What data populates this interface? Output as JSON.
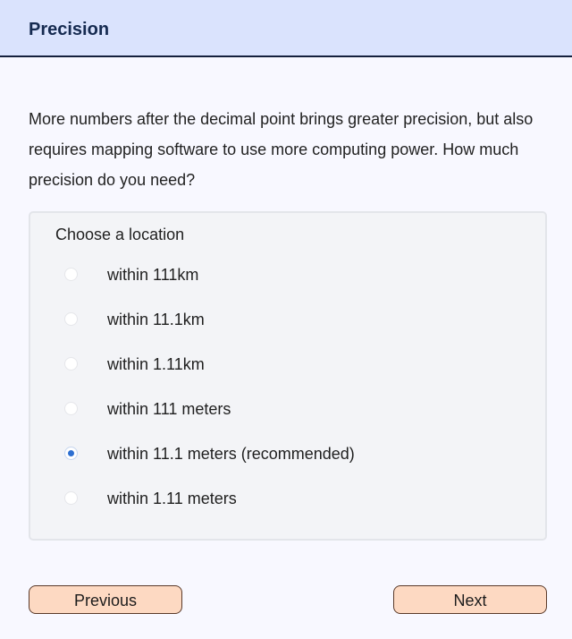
{
  "header": {
    "title": "Precision"
  },
  "intro": {
    "text": "More numbers after the decimal point brings greater precision, but also requires mapping software to use more computing power. How much precision do you need?"
  },
  "question": {
    "legend": "Choose a location",
    "options": [
      {
        "label": "within 111km",
        "checked": false
      },
      {
        "label": "within 11.1km",
        "checked": false
      },
      {
        "label": "within 1.11km",
        "checked": false
      },
      {
        "label": "within 111 meters",
        "checked": false
      },
      {
        "label": "within 11.1 meters (recommended)",
        "checked": true
      },
      {
        "label": "within 1.11 meters",
        "checked": false
      }
    ]
  },
  "nav": {
    "previous_label": "Previous",
    "next_label": "Next"
  },
  "colors": {
    "header_bg": "#dae3fd",
    "header_border": "#14203d",
    "radio_accent": "#2d6fd1",
    "button_bg": "#fdd9c2"
  }
}
